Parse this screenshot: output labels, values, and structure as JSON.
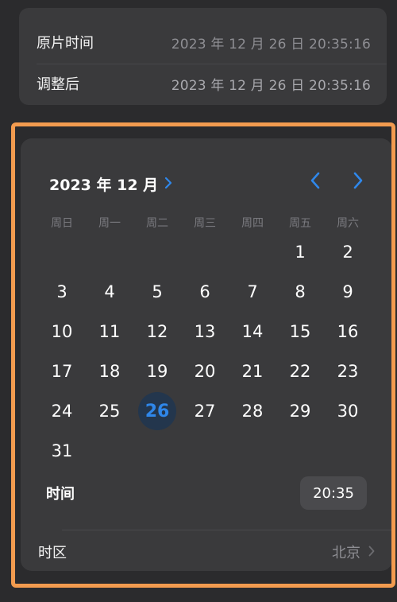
{
  "info": {
    "original_label": "原片时间",
    "original_value": "2023 年 12 月 26 日 20:35:16",
    "adjusted_label": "调整后",
    "adjusted_value": "2023 年 12 月 26 日 20:35:16"
  },
  "picker": {
    "month_title": "2023 年 12 月",
    "weekdays": [
      "周日",
      "周一",
      "周二",
      "周三",
      "周四",
      "周五",
      "周六"
    ],
    "first_weekday_index": 5,
    "days": [
      "1",
      "2",
      "3",
      "4",
      "5",
      "6",
      "7",
      "8",
      "9",
      "10",
      "11",
      "12",
      "13",
      "14",
      "15",
      "16",
      "17",
      "18",
      "19",
      "20",
      "21",
      "22",
      "23",
      "24",
      "25",
      "26",
      "27",
      "28",
      "29",
      "30",
      "31"
    ],
    "selected_day": "26",
    "time_label": "时间",
    "time_value": "20:35",
    "timezone_label": "时区",
    "timezone_value": "北京"
  },
  "colors": {
    "accent": "#2f87ea",
    "highlight_frame": "#f29b4f",
    "background": "#2b2b2d",
    "card": "#3a3a3c"
  },
  "icons": {
    "month_expand": "chevron-right-icon",
    "prev_month": "chevron-left-icon",
    "next_month": "chevron-right-icon",
    "timezone_disclosure": "chevron-right-icon"
  }
}
